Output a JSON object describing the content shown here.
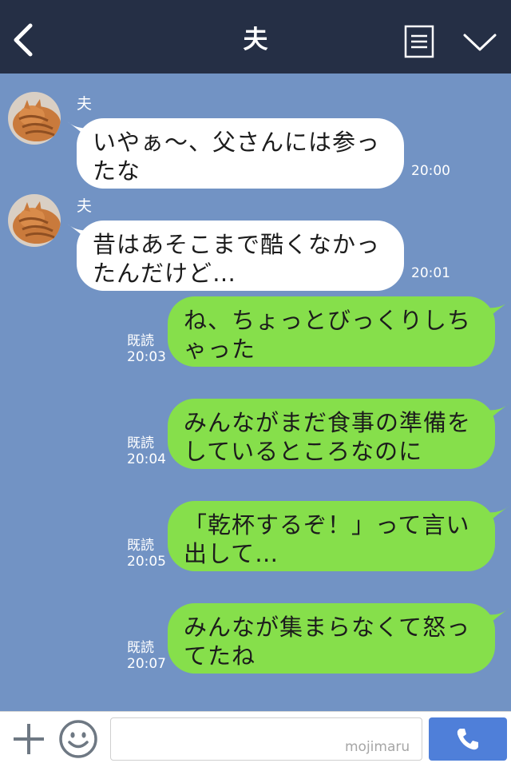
{
  "header": {
    "title": "夫",
    "back_icon": "chevron-left-icon",
    "menu_icon": "list-icon",
    "collapse_icon": "chevron-down-icon"
  },
  "messages": [
    {
      "direction": "in",
      "sender": "夫",
      "text": "いやぁ〜、父さんには参っ\nたな",
      "time": "20:00"
    },
    {
      "direction": "in",
      "sender": "夫",
      "text": "昔はあそこまで酷くなかっ\nたんだけど…",
      "time": "20:01"
    },
    {
      "direction": "out",
      "read": "既読",
      "text": "ね、ちょっとびっくりしち\nゃった",
      "time": "20:03"
    },
    {
      "direction": "out",
      "read": "既読",
      "text": "みんながまだ食事の準備を\nしているところなのに",
      "time": "20:04"
    },
    {
      "direction": "out",
      "read": "既読",
      "text": "「乾杯するぞ！」って言い\n出して…",
      "time": "20:05"
    },
    {
      "direction": "out",
      "read": "既読",
      "text": "みんなが集まらなくて怒っ\nてたね",
      "time": "20:07"
    }
  ],
  "input": {
    "value": "",
    "watermark": "mojimaru"
  },
  "colors": {
    "header_bg": "#252f45",
    "chat_bg": "#7293c4",
    "outgoing_bubble": "#86df4b",
    "incoming_bubble": "#ffffff",
    "call_button": "#4f7fd9"
  }
}
